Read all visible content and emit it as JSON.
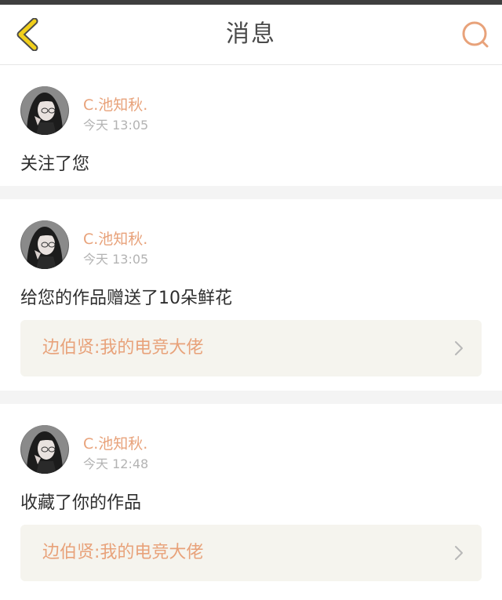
{
  "header": {
    "title": "消息",
    "back_icon": "chevron-left-icon",
    "search_icon": "search-icon",
    "accent_color": "#e8a27a",
    "back_color": "#f1cf1b"
  },
  "notifications": [
    {
      "username": "C.池知秋.",
      "time": "今天 13:05",
      "action": "关注了您"
    },
    {
      "username": "C.池知秋.",
      "time": "今天 13:05",
      "action": "给您的作品赠送了10朵鲜花",
      "work_title": "边伯贤:我的电竞大佬"
    },
    {
      "username": "C.池知秋.",
      "time": "今天 12:48",
      "action": "收藏了你的作品",
      "work_title": "边伯贤:我的电竞大佬"
    }
  ]
}
